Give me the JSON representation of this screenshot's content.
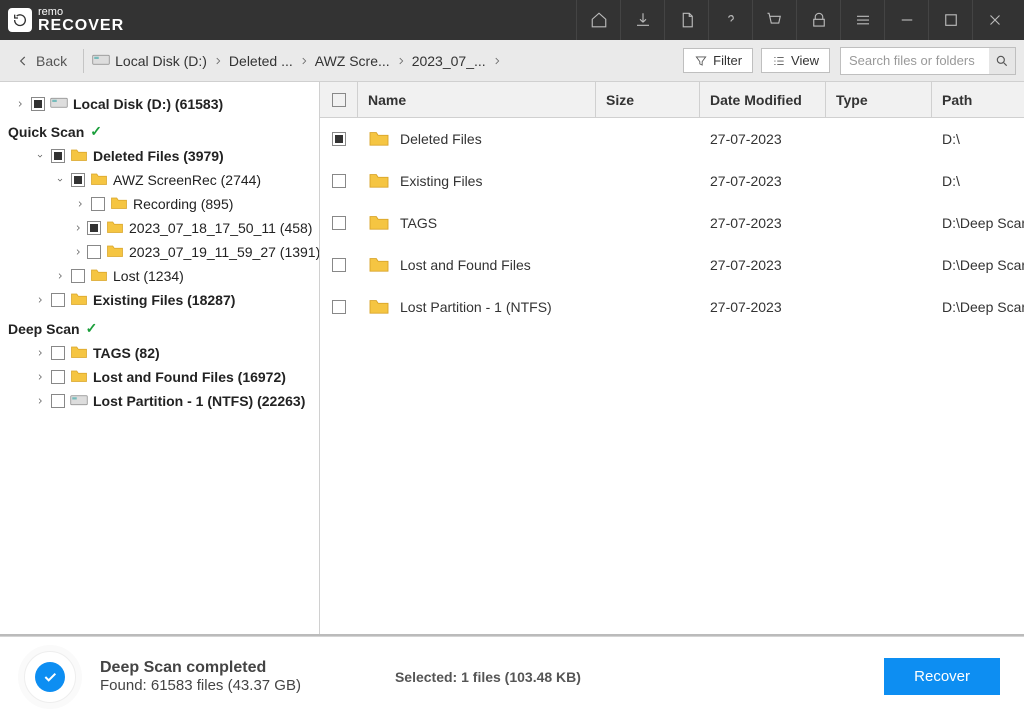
{
  "brand": {
    "name_small": "remo",
    "name_big": "RECOVER"
  },
  "toolbar": {
    "back": "Back",
    "filter": "Filter",
    "view": "View"
  },
  "search": {
    "placeholder": "Search files or folders"
  },
  "breadcrumb": [
    {
      "label": "Local Disk (D:)"
    },
    {
      "label": "Deleted ..."
    },
    {
      "label": "AWZ Scre..."
    },
    {
      "label": "2023_07_..."
    }
  ],
  "sidebar": {
    "root": {
      "label": "Local Disk (D:) (61583)"
    },
    "quick_scan_label": "Quick Scan",
    "deep_scan_label": "Deep Scan",
    "tree": [
      {
        "label": "Deleted Files (3979)",
        "indent": 2,
        "bold": true,
        "expanded": true,
        "checked": "partial"
      },
      {
        "label": "AWZ ScreenRec (2744)",
        "indent": 3,
        "expanded": true,
        "checked": "partial"
      },
      {
        "label": "Recording (895)",
        "indent": 4,
        "collapsed": true
      },
      {
        "label": "2023_07_18_17_50_11 (458)",
        "indent": 4,
        "collapsed": true,
        "checked": "partial"
      },
      {
        "label": "2023_07_19_11_59_27 (1391)",
        "indent": 4,
        "collapsed": true
      },
      {
        "label": "Lost (1234)",
        "indent": 3,
        "collapsed": true
      },
      {
        "label": "Existing Files (18287)",
        "indent": 2,
        "bold": true,
        "collapsed": true
      }
    ],
    "deep": [
      {
        "label": "TAGS (82)",
        "indent": 2,
        "bold": true,
        "collapsed": true
      },
      {
        "label": "Lost and Found Files (16972)",
        "indent": 2,
        "bold": true,
        "collapsed": true
      },
      {
        "label": "Lost Partition - 1 (NTFS) (22263)",
        "indent": 2,
        "bold": true,
        "collapsed": true,
        "disk": true
      }
    ]
  },
  "columns": {
    "name": "Name",
    "size": "Size",
    "date": "Date Modified",
    "type": "Type",
    "path": "Path"
  },
  "rows": [
    {
      "name": "Deleted Files",
      "size": "",
      "date": "27-07-2023",
      "type": "",
      "path": "D:\\",
      "checked": "partial"
    },
    {
      "name": "Existing Files",
      "size": "",
      "date": "27-07-2023",
      "type": "",
      "path": "D:\\"
    },
    {
      "name": "TAGS",
      "size": "",
      "date": "27-07-2023",
      "type": "",
      "path": "D:\\Deep Scan"
    },
    {
      "name": "Lost and Found Files",
      "size": "",
      "date": "27-07-2023",
      "type": "",
      "path": "D:\\Deep Scan"
    },
    {
      "name": "Lost Partition - 1 (NTFS)",
      "size": "",
      "date": "27-07-2023",
      "type": "",
      "path": "D:\\Deep Scan"
    }
  ],
  "footer": {
    "status_title": "Deep Scan completed",
    "found_label": "Found:",
    "found_value": "61583 files (43.37 GB)",
    "selected": "Selected: 1 files (103.48 KB)",
    "recover": "Recover"
  }
}
